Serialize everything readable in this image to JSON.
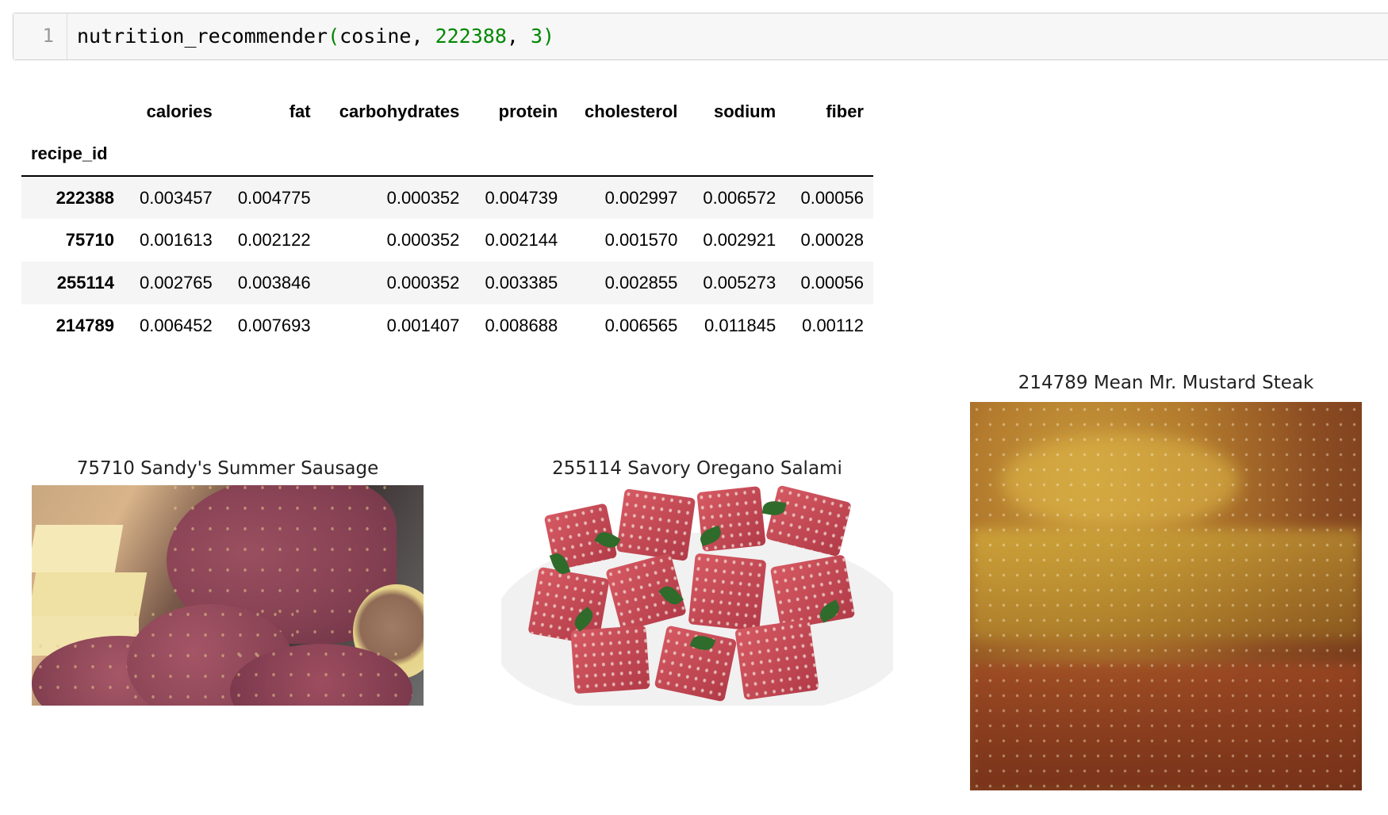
{
  "cell": {
    "line_number": "1",
    "code_func": "nutrition_recommender",
    "code_paren_open": "(",
    "code_arg1": "cosine, ",
    "code_arg2": "222388",
    "code_sep": ", ",
    "code_arg3": "3",
    "code_paren_close": ")"
  },
  "table": {
    "columns": [
      "calories",
      "fat",
      "carbohydrates",
      "protein",
      "cholesterol",
      "sodium",
      "fiber"
    ],
    "index_name": "recipe_id",
    "rows": [
      {
        "id": "222388",
        "values": [
          "0.003457",
          "0.004775",
          "0.000352",
          "0.004739",
          "0.002997",
          "0.006572",
          "0.00056"
        ]
      },
      {
        "id": "75710",
        "values": [
          "0.001613",
          "0.002122",
          "0.000352",
          "0.002144",
          "0.001570",
          "0.002921",
          "0.00028"
        ]
      },
      {
        "id": "255114",
        "values": [
          "0.002765",
          "0.003846",
          "0.000352",
          "0.003385",
          "0.002855",
          "0.005273",
          "0.00056"
        ]
      },
      {
        "id": "214789",
        "values": [
          "0.006452",
          "0.007693",
          "0.001407",
          "0.008688",
          "0.006565",
          "0.011845",
          "0.00112"
        ]
      }
    ]
  },
  "figures": [
    {
      "title": "75710  Sandy's Summer Sausage"
    },
    {
      "title": "255114  Savory Oregano Salami"
    },
    {
      "title": "214789  Mean Mr. Mustard Steak"
    }
  ]
}
